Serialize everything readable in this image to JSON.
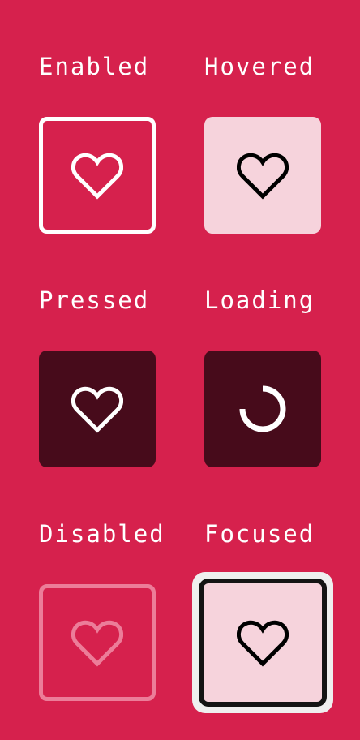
{
  "states": {
    "enabled": {
      "label": "Enabled",
      "icon": "heart-outline-icon",
      "color": "#ffffff"
    },
    "hovered": {
      "label": "Hovered",
      "icon": "heart-outline-icon",
      "color": "#000000"
    },
    "pressed": {
      "label": "Pressed",
      "icon": "heart-outline-icon",
      "color": "#ffffff"
    },
    "loading": {
      "label": "Loading",
      "icon": "spinner-icon",
      "color": "#ffffff"
    },
    "disabled": {
      "label": "Disabled",
      "icon": "heart-outline-icon",
      "color": "#ec7d99"
    },
    "focused": {
      "label": "Focused",
      "icon": "heart-outline-icon",
      "color": "#000000"
    }
  },
  "colors": {
    "background": "#d6214d",
    "hover_fill": "#f6d3dc",
    "pressed_fill": "#470b1b",
    "focus_ring": "#efefef",
    "focus_border": "#141414"
  }
}
